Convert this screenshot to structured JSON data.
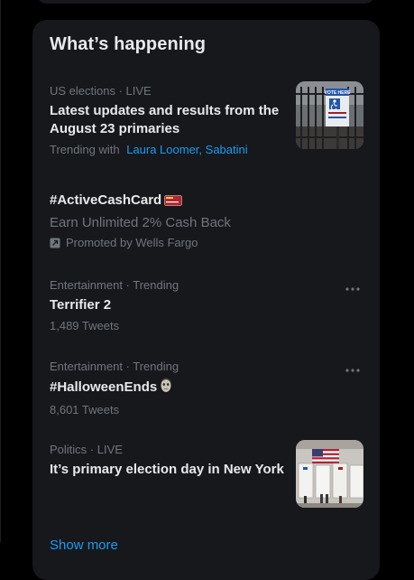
{
  "panel": {
    "title": "What’s happening",
    "show_more": "Show more"
  },
  "trends": [
    {
      "context": "US elections · LIVE",
      "headline": "Latest updates and results from the August 23 primaries",
      "trending_with_label": "Trending with",
      "trending_with": [
        "Laura Loomer",
        "Sabatini"
      ],
      "trending_with_separator": ", ",
      "thumbnail": "vote-here-sign-photo",
      "sign_text": "VOTE HERE"
    },
    {
      "headline": "#ActiveCashCard",
      "subtitle": "Earn Unlimited 2% Cash Back",
      "promoted_by": "Promoted by Wells Fargo",
      "icons": [
        "card-emoji-icon",
        "promoted-icon"
      ]
    },
    {
      "context": "Entertainment · Trending",
      "headline": "Terrifier 2",
      "count": "1,489 Tweets",
      "icon": "more-icon"
    },
    {
      "context": "Entertainment · Trending",
      "headline": "#HalloweenEnds",
      "count": "8,601 Tweets",
      "icons": [
        "mask-emoji-icon",
        "more-icon"
      ]
    },
    {
      "context": "Politics · LIVE",
      "headline": "It’s primary election day in New York",
      "thumbnail": "voting-booths-photo"
    }
  ],
  "colors": {
    "background": "#000000",
    "panel": "#16181c",
    "text_primary": "#e7e9ea",
    "text_secondary": "#71767b",
    "accent": "#1d9bf0"
  }
}
